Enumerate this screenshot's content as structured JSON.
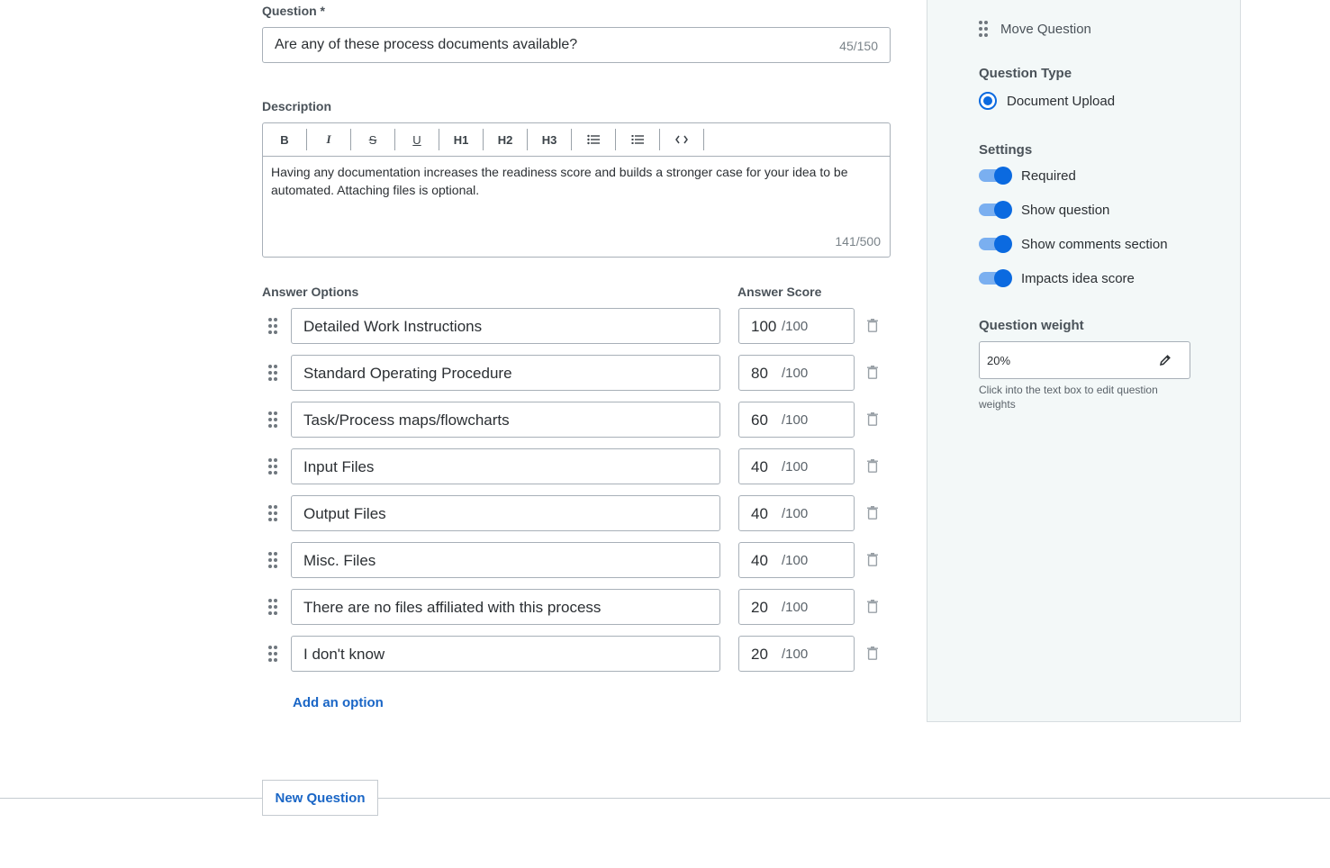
{
  "question": {
    "label": "Question *",
    "value": "Are any of these process documents available?",
    "count": "45/150"
  },
  "description": {
    "label": "Description",
    "toolbar": [
      "B",
      "I",
      "S",
      "U",
      "H1",
      "H2",
      "H3",
      "bullet-list",
      "numbered-list",
      "code"
    ],
    "text": "Having any documentation increases the readiness score and builds a stronger case for your idea to be automated. Attaching files is optional.",
    "count": "141/500"
  },
  "answers": {
    "options_label": "Answer Options",
    "score_label": "Answer Score",
    "max": "/100",
    "items": [
      {
        "option": "Detailed Work Instructions",
        "score": "100"
      },
      {
        "option": "Standard Operating Procedure",
        "score": "80"
      },
      {
        "option": "Task/Process maps/flowcharts",
        "score": "60"
      },
      {
        "option": "Input Files",
        "score": "40"
      },
      {
        "option": "Output Files",
        "score": "40"
      },
      {
        "option": "Misc. Files",
        "score": "40"
      },
      {
        "option": "There are no files affiliated with this process",
        "score": "20"
      },
      {
        "option": "I don't know",
        "score": "20"
      }
    ],
    "add_label": "Add an option"
  },
  "new_question_label": "New Question",
  "sidebar": {
    "move_label": "Move Question",
    "type_heading": "Question Type",
    "type_value": "Document Upload",
    "settings_heading": "Settings",
    "settings": [
      {
        "label": "Required",
        "on": true
      },
      {
        "label": "Show question",
        "on": true
      },
      {
        "label": "Show comments section",
        "on": true
      },
      {
        "label": "Impacts idea score",
        "on": true
      }
    ],
    "weight_heading": "Question weight",
    "weight_value": "20%",
    "weight_hint": "Click into the text box to edit question weights"
  },
  "colors": {
    "accent": "#0b6ae0",
    "link": "#1a66c6",
    "panel": "#f3f8f8"
  }
}
